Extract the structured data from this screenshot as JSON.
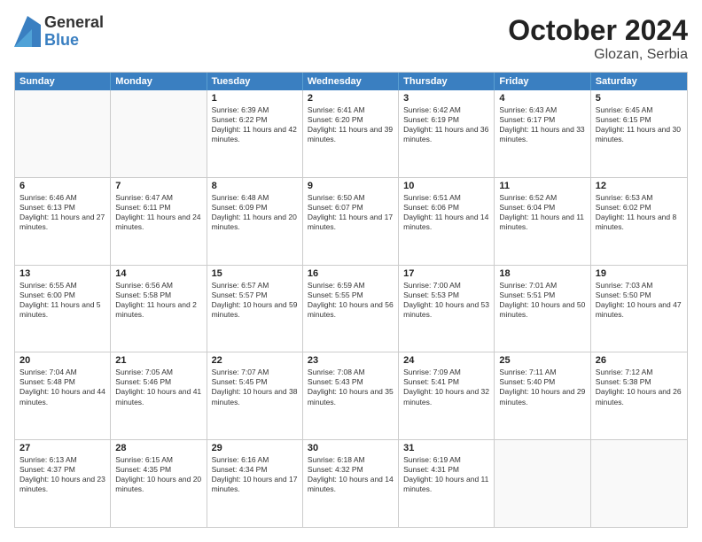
{
  "logo": {
    "general": "General",
    "blue": "Blue"
  },
  "title": "October 2024",
  "location": "Glozan, Serbia",
  "days": [
    "Sunday",
    "Monday",
    "Tuesday",
    "Wednesday",
    "Thursday",
    "Friday",
    "Saturday"
  ],
  "rows": [
    [
      {
        "day": "",
        "text": "",
        "empty": true
      },
      {
        "day": "",
        "text": "",
        "empty": true
      },
      {
        "day": "1",
        "text": "Sunrise: 6:39 AM\nSunset: 6:22 PM\nDaylight: 11 hours and 42 minutes."
      },
      {
        "day": "2",
        "text": "Sunrise: 6:41 AM\nSunset: 6:20 PM\nDaylight: 11 hours and 39 minutes."
      },
      {
        "day": "3",
        "text": "Sunrise: 6:42 AM\nSunset: 6:19 PM\nDaylight: 11 hours and 36 minutes."
      },
      {
        "day": "4",
        "text": "Sunrise: 6:43 AM\nSunset: 6:17 PM\nDaylight: 11 hours and 33 minutes."
      },
      {
        "day": "5",
        "text": "Sunrise: 6:45 AM\nSunset: 6:15 PM\nDaylight: 11 hours and 30 minutes."
      }
    ],
    [
      {
        "day": "6",
        "text": "Sunrise: 6:46 AM\nSunset: 6:13 PM\nDaylight: 11 hours and 27 minutes."
      },
      {
        "day": "7",
        "text": "Sunrise: 6:47 AM\nSunset: 6:11 PM\nDaylight: 11 hours and 24 minutes."
      },
      {
        "day": "8",
        "text": "Sunrise: 6:48 AM\nSunset: 6:09 PM\nDaylight: 11 hours and 20 minutes."
      },
      {
        "day": "9",
        "text": "Sunrise: 6:50 AM\nSunset: 6:07 PM\nDaylight: 11 hours and 17 minutes."
      },
      {
        "day": "10",
        "text": "Sunrise: 6:51 AM\nSunset: 6:06 PM\nDaylight: 11 hours and 14 minutes."
      },
      {
        "day": "11",
        "text": "Sunrise: 6:52 AM\nSunset: 6:04 PM\nDaylight: 11 hours and 11 minutes."
      },
      {
        "day": "12",
        "text": "Sunrise: 6:53 AM\nSunset: 6:02 PM\nDaylight: 11 hours and 8 minutes."
      }
    ],
    [
      {
        "day": "13",
        "text": "Sunrise: 6:55 AM\nSunset: 6:00 PM\nDaylight: 11 hours and 5 minutes."
      },
      {
        "day": "14",
        "text": "Sunrise: 6:56 AM\nSunset: 5:58 PM\nDaylight: 11 hours and 2 minutes."
      },
      {
        "day": "15",
        "text": "Sunrise: 6:57 AM\nSunset: 5:57 PM\nDaylight: 10 hours and 59 minutes."
      },
      {
        "day": "16",
        "text": "Sunrise: 6:59 AM\nSunset: 5:55 PM\nDaylight: 10 hours and 56 minutes."
      },
      {
        "day": "17",
        "text": "Sunrise: 7:00 AM\nSunset: 5:53 PM\nDaylight: 10 hours and 53 minutes."
      },
      {
        "day": "18",
        "text": "Sunrise: 7:01 AM\nSunset: 5:51 PM\nDaylight: 10 hours and 50 minutes."
      },
      {
        "day": "19",
        "text": "Sunrise: 7:03 AM\nSunset: 5:50 PM\nDaylight: 10 hours and 47 minutes."
      }
    ],
    [
      {
        "day": "20",
        "text": "Sunrise: 7:04 AM\nSunset: 5:48 PM\nDaylight: 10 hours and 44 minutes."
      },
      {
        "day": "21",
        "text": "Sunrise: 7:05 AM\nSunset: 5:46 PM\nDaylight: 10 hours and 41 minutes."
      },
      {
        "day": "22",
        "text": "Sunrise: 7:07 AM\nSunset: 5:45 PM\nDaylight: 10 hours and 38 minutes."
      },
      {
        "day": "23",
        "text": "Sunrise: 7:08 AM\nSunset: 5:43 PM\nDaylight: 10 hours and 35 minutes."
      },
      {
        "day": "24",
        "text": "Sunrise: 7:09 AM\nSunset: 5:41 PM\nDaylight: 10 hours and 32 minutes."
      },
      {
        "day": "25",
        "text": "Sunrise: 7:11 AM\nSunset: 5:40 PM\nDaylight: 10 hours and 29 minutes."
      },
      {
        "day": "26",
        "text": "Sunrise: 7:12 AM\nSunset: 5:38 PM\nDaylight: 10 hours and 26 minutes."
      }
    ],
    [
      {
        "day": "27",
        "text": "Sunrise: 6:13 AM\nSunset: 4:37 PM\nDaylight: 10 hours and 23 minutes."
      },
      {
        "day": "28",
        "text": "Sunrise: 6:15 AM\nSunset: 4:35 PM\nDaylight: 10 hours and 20 minutes."
      },
      {
        "day": "29",
        "text": "Sunrise: 6:16 AM\nSunset: 4:34 PM\nDaylight: 10 hours and 17 minutes."
      },
      {
        "day": "30",
        "text": "Sunrise: 6:18 AM\nSunset: 4:32 PM\nDaylight: 10 hours and 14 minutes."
      },
      {
        "day": "31",
        "text": "Sunrise: 6:19 AM\nSunset: 4:31 PM\nDaylight: 10 hours and 11 minutes."
      },
      {
        "day": "",
        "text": "",
        "empty": true
      },
      {
        "day": "",
        "text": "",
        "empty": true
      }
    ]
  ]
}
